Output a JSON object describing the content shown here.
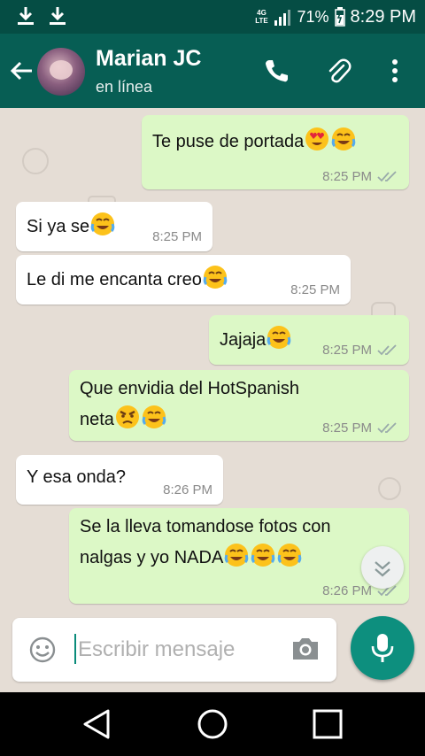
{
  "status_bar": {
    "network": "4G LTE",
    "battery": "71%",
    "time": "8:29 PM"
  },
  "header": {
    "contact_name": "Marian JC",
    "contact_status": "en línea",
    "icons": [
      "back-arrow-icon",
      "phone-icon",
      "paperclip-icon",
      "more-vert-icon"
    ]
  },
  "messages": [
    {
      "dir": "out",
      "text": "Te puse de portada",
      "emojis": [
        "heart-eyes",
        "joy"
      ],
      "time": "8:25 PM",
      "read": true
    },
    {
      "dir": "in",
      "text": "Si ya se",
      "emojis": [
        "joy"
      ],
      "time": "8:25 PM"
    },
    {
      "dir": "in",
      "text": "Le di me encanta creo",
      "emojis": [
        "joy"
      ],
      "time": "8:25 PM"
    },
    {
      "dir": "out",
      "text": "Jajaja",
      "emojis": [
        "joy"
      ],
      "time": "8:25 PM",
      "read": true
    },
    {
      "dir": "out",
      "text": "Que envidia del HotSpanish",
      "text2": "neta",
      "emojis": [
        "angry",
        "joy"
      ],
      "time": "8:25 PM",
      "read": true
    },
    {
      "dir": "in",
      "text": "Y esa onda?",
      "emojis": [],
      "time": "8:26 PM"
    },
    {
      "dir": "out",
      "text": "Se la lleva tomandose fotos con",
      "text2": "nalgas y yo NADA",
      "emojis": [
        "joy",
        "joy",
        "joy"
      ],
      "time": "8:26 PM",
      "read": true
    }
  ],
  "composer": {
    "placeholder": "Escribir mensaje"
  },
  "colors": {
    "header": "#075e54",
    "status": "#054d44",
    "outgoing": "#dcf8c6",
    "incoming": "#ffffff",
    "chat_bg": "#e5ddd5",
    "accent": "#0d8f7e"
  }
}
